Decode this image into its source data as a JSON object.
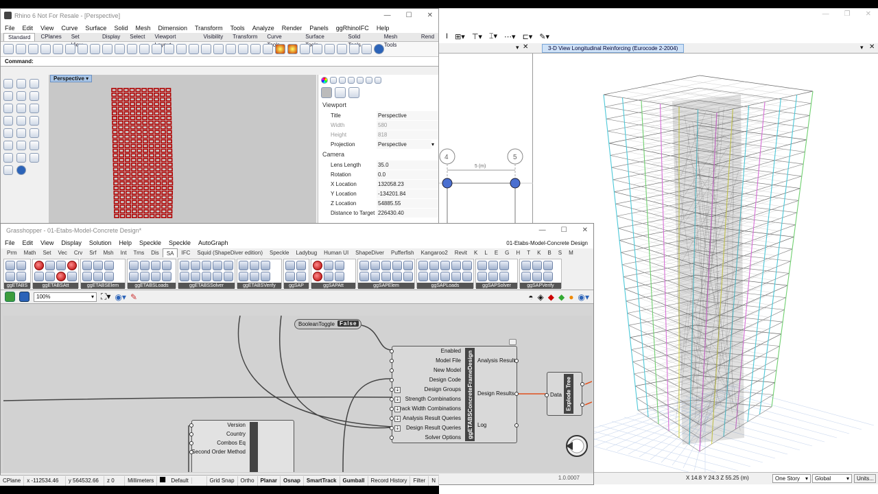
{
  "rhino": {
    "title": "Rhino 6 Not For Resale - [Perspective]",
    "menu": [
      "File",
      "Edit",
      "View",
      "Curve",
      "Surface",
      "Solid",
      "Mesh",
      "Dimension",
      "Transform",
      "Tools",
      "Analyze",
      "Render",
      "Panels",
      "ggRhinoIFC",
      "Help"
    ],
    "tabs": [
      "Standard",
      "CPlanes",
      "Set View",
      "Display",
      "Select",
      "Viewport Layout",
      "Visibility",
      "Transform",
      "Curve Tools",
      "Surface Tools",
      "Solid Tools",
      "Mesh Tools",
      "Rend"
    ],
    "command_label": "Command:",
    "viewport_label": "Perspective",
    "properties": {
      "viewport_header": "Viewport",
      "camera_header": "Camera",
      "viewport": [
        {
          "key": "Title",
          "value": "Perspective"
        },
        {
          "key": "Width",
          "value": "580"
        },
        {
          "key": "Height",
          "value": "818"
        },
        {
          "key": "Projection",
          "value": "Perspective"
        }
      ],
      "camera": [
        {
          "key": "Lens Length",
          "value": "35.0"
        },
        {
          "key": "Rotation",
          "value": "0.0"
        },
        {
          "key": "X Location",
          "value": "132058.23"
        },
        {
          "key": "Y Location",
          "value": "-134201.84"
        },
        {
          "key": "Z Location",
          "value": "54885.55"
        },
        {
          "key": "Distance to Target",
          "value": "226430.40"
        }
      ]
    },
    "status": {
      "cplane": "CPlane",
      "x": "x -112534.46",
      "y": "y 564532.66",
      "z": "z 0",
      "units": "Millimeters",
      "layer": "Default",
      "toggles": [
        "Grid Snap",
        "Ortho",
        "Planar",
        "Osnap",
        "SmartTrack",
        "Gumball",
        "Record History",
        "Filter",
        "N"
      ]
    }
  },
  "grasshopper": {
    "title": "Grasshopper - 01-Etabs-Model-Concrete Design*",
    "doc_name": "01-Etabs-Model-Concrete Design",
    "menu": [
      "File",
      "Edit",
      "View",
      "Display",
      "Solution",
      "Help",
      "Speckle",
      "Speckle",
      "AutoGraph"
    ],
    "categories": [
      "Prm",
      "Math",
      "Set",
      "Vec",
      "Crv",
      "Srf",
      "Msh",
      "Int",
      "Trns",
      "Dis",
      "SA",
      "IFC",
      "Squid (ShapeDiver edition)",
      "Speckle",
      "Ladybug",
      "Human UI",
      "ShapeDiver",
      "Pufferfish",
      "Kangaroo2",
      "Revit",
      "K",
      "L",
      "E",
      "G",
      "H",
      "T",
      "K",
      "B",
      "S",
      "M"
    ],
    "active_category": "SA",
    "ribbon_groups": [
      "ggETABS",
      "ggETABSAtt",
      "ggETABSElem",
      "ggETABSLoads",
      "ggETABSSolver",
      "ggETABSVerify",
      "ggSAP",
      "ggSAPAtt",
      "ggSAPElem",
      "ggSAPLoads",
      "ggSAPSolver",
      "ggSAPVerify"
    ],
    "zoom": "100%",
    "nodes": {
      "toggle_label": "BooleanToggle",
      "toggle_value": "False",
      "design_name": "ggETABSConcreteFrameDesign",
      "design_inputs": [
        "Enabled",
        "Model File",
        "New Model",
        "Design Code",
        "Design Groups",
        "Strength Combinations",
        "Crack Width Combinations",
        "Analysis Result Queries",
        "Design Result Queries",
        "Solver Options"
      ],
      "design_outputs": [
        "Analysis Results",
        "Design Results",
        "Log"
      ],
      "explode_name": "Explode Tree",
      "explode_input": "Data",
      "settings_inputs": [
        "Version",
        "Country",
        "Combos Eq",
        "Second Order Method"
      ]
    },
    "version": "1.0.0007"
  },
  "etabs": {
    "view_tab": "3-D View  Longitudinal Reinforcing  (Eurocode 2-2004)",
    "grid_labels": [
      "4",
      "5"
    ],
    "dimension": "5 (m)",
    "status_coords": "X 14.8  Y 24.3  Z 55.25 (m)",
    "story_select": "One Story",
    "coord_select": "Global",
    "units_button": "Units..."
  }
}
